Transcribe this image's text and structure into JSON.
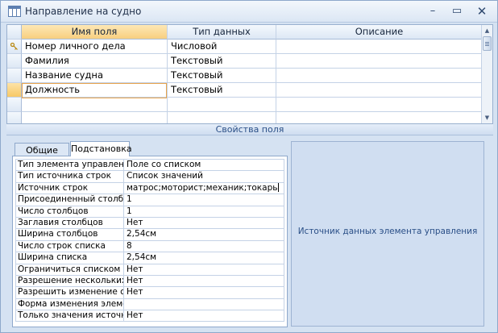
{
  "window": {
    "title": "Направление на судно",
    "minimize": "–",
    "maximize": "▭",
    "close": "✕"
  },
  "grid": {
    "columns": [
      "Имя поля",
      "Тип данных",
      "Описание"
    ],
    "rows": [
      {
        "name": "Номер личного дела",
        "type": "Числовой",
        "description": "",
        "key": true
      },
      {
        "name": "Фамилия",
        "type": "Текстовый",
        "description": "",
        "key": false
      },
      {
        "name": "Название судна",
        "type": "Текстовый",
        "description": "",
        "key": false
      },
      {
        "name": "Должность",
        "type": "Текстовый",
        "description": "",
        "key": false,
        "current": true
      }
    ]
  },
  "properties": {
    "header": "Свойства поля",
    "tabs": [
      "Общие",
      "Подстановка"
    ],
    "active_tab": "Подстановка",
    "rows": [
      {
        "name": "Тип элемента управления",
        "value": "Поле со списком"
      },
      {
        "name": "Тип источника строк",
        "value": "Список значений"
      },
      {
        "name": "Источник строк",
        "value": "матрос;моторист;механик;токарь",
        "selected": true
      },
      {
        "name": "Присоединенный столбец",
        "value": "1"
      },
      {
        "name": "Число столбцов",
        "value": "1"
      },
      {
        "name": "Заглавия столбцов",
        "value": "Нет"
      },
      {
        "name": "Ширина столбцов",
        "value": "2,54см"
      },
      {
        "name": "Число строк списка",
        "value": "8"
      },
      {
        "name": "Ширина списка",
        "value": "2,54см"
      },
      {
        "name": "Ограничиться списком",
        "value": "Нет"
      },
      {
        "name": "Разрешение нескольких значений",
        "value": "Нет"
      },
      {
        "name": "Разрешить изменение списка значений",
        "value": "Нет"
      },
      {
        "name": "Форма изменения элементов списка",
        "value": ""
      },
      {
        "name": "Только значения источника строк",
        "value": "Нет"
      }
    ],
    "help_text": "Источник данных элемента управления"
  },
  "colors": {
    "accent_selection": "#f8cf7f",
    "window_bg": "#d5e2f2",
    "header_text": "#2a4f87"
  }
}
